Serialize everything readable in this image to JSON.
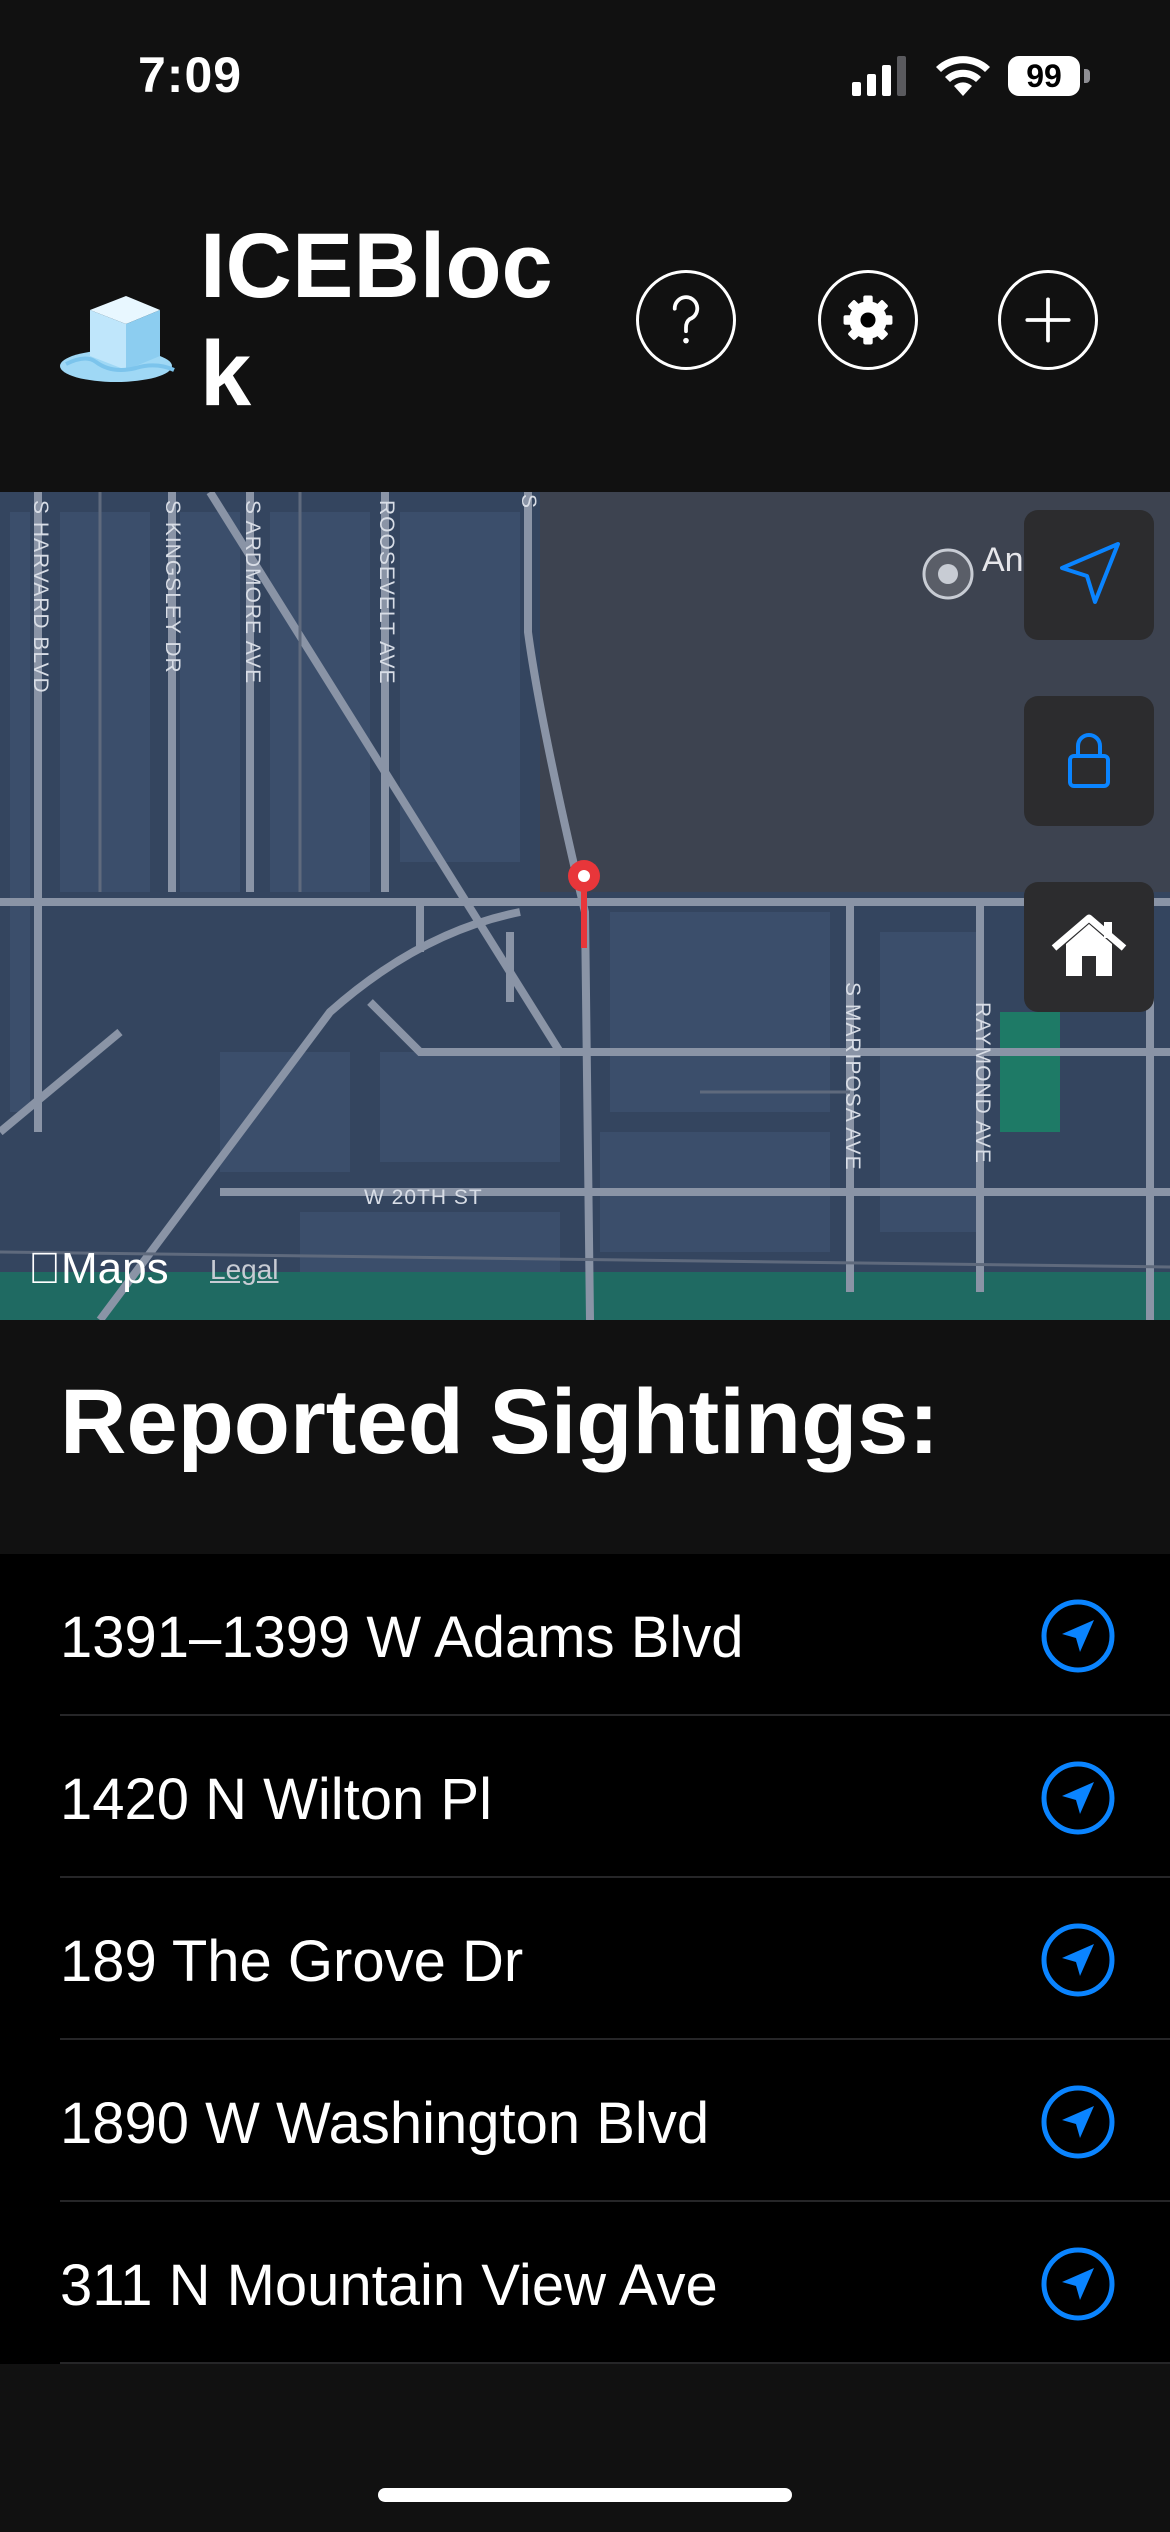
{
  "status_bar": {
    "time": "7:09",
    "battery": "99"
  },
  "header": {
    "title": "ICEBlock",
    "logo_icon": "ice-cube-icon",
    "buttons": {
      "help": "question-icon",
      "settings": "gear-icon",
      "add": "plus-icon"
    }
  },
  "map": {
    "streets": [
      "S HARVARD BLVD",
      "S KINGSLEY DR",
      "S ARDMORE AVE",
      "ROOSEVELT AVE",
      "S",
      "S MARIPOSA AVE",
      "RAYMOND AVE",
      "W 20TH ST"
    ],
    "poi": "An Ce",
    "brand": "Maps",
    "legal": "Legal",
    "controls": [
      "location-arrow-icon",
      "lock-icon",
      "home-icon"
    ],
    "accent": "#0a84ff",
    "pin_color": "#e8363a"
  },
  "sightings": {
    "title": "Reported Sightings:",
    "items": [
      {
        "address": "1391–1399 W Adams Blvd"
      },
      {
        "address": "1420 N Wilton Pl"
      },
      {
        "address": "189 The Grove Dr"
      },
      {
        "address": "1890 W Washington Blvd"
      },
      {
        "address": "311 N Mountain View Ave"
      }
    ]
  }
}
